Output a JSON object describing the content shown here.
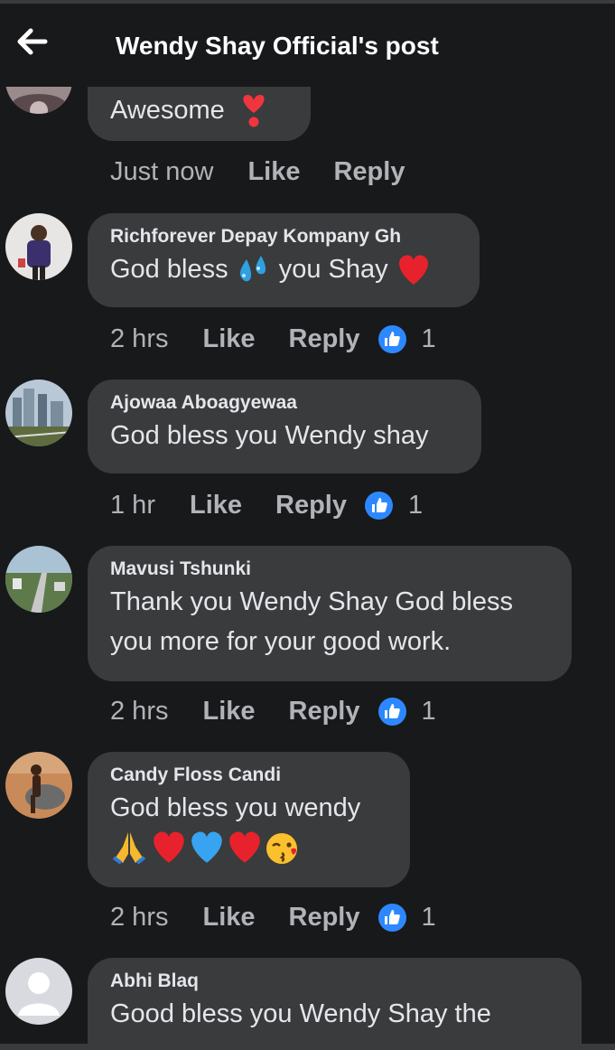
{
  "header": {
    "back_icon": "arrow-left-icon",
    "title": "Wendy Shay Official's post"
  },
  "comments": [
    {
      "author": "",
      "text": "Awesome",
      "time": "Just now",
      "like": "Like",
      "reply": "Reply",
      "reactions": ""
    },
    {
      "author": "Richforever Depay Kompany Gh",
      "text_a": "God bless",
      "text_b": "you Shay",
      "time": "2 hrs",
      "like": "Like",
      "reply": "Reply",
      "reactions": "1"
    },
    {
      "author": "Ajowaa Aboagyewaa",
      "text": "God bless you Wendy shay",
      "time": "1 hr",
      "like": "Like",
      "reply": "Reply",
      "reactions": "1"
    },
    {
      "author": "Mavusi Tshunki",
      "text_line1": "Thank you Wendy Shay God bless",
      "text_line2": "you more for your good work.",
      "time": "2 hrs",
      "like": "Like",
      "reply": "Reply",
      "reactions": "1"
    },
    {
      "author": "Candy Floss Candi",
      "text": "God bless you wendy",
      "time": "2 hrs",
      "like": "Like",
      "reply": "Reply",
      "reactions": "1"
    },
    {
      "author": "Abhi Blaq",
      "text": "Good bless you Wendy Shay the"
    }
  ],
  "icons": {
    "heart_exclamation": "heart-exclamation-icon",
    "sweat_drops": "sweat-droplets-icon",
    "red_heart": "red-heart-icon",
    "like_badge": "thumbs-up-icon"
  },
  "colors": {
    "background": "#18191a",
    "bubble": "#3a3b3c",
    "like_blue": "#2d88ff",
    "secondary_text": "#b0b3b8"
  }
}
